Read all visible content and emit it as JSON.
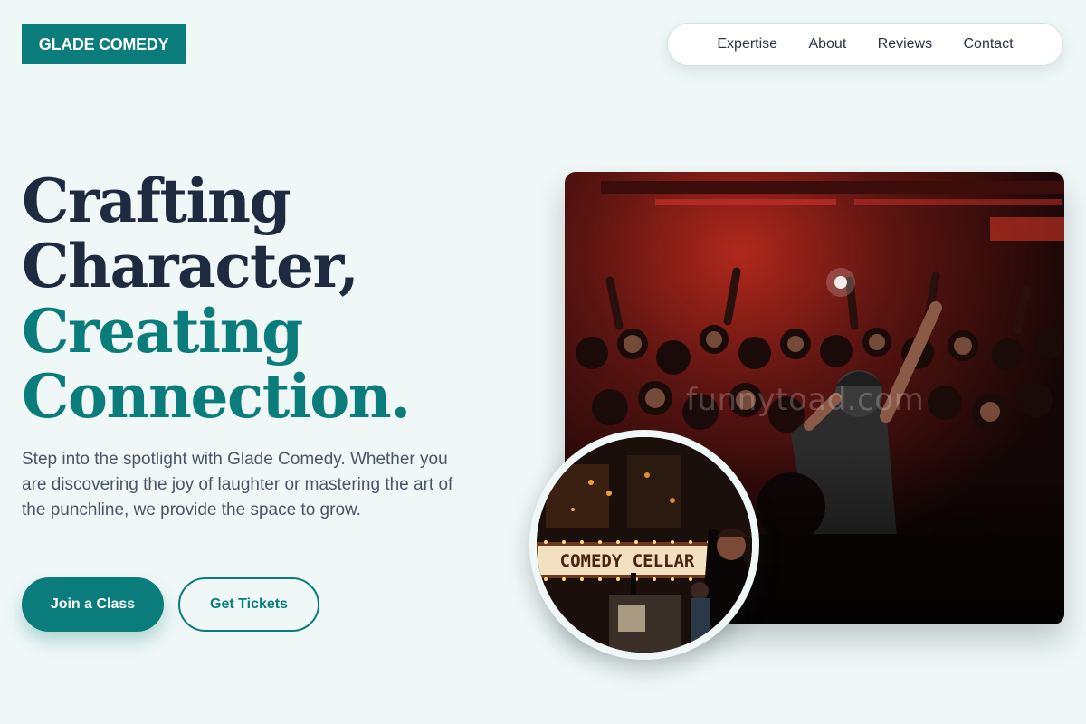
{
  "brand": {
    "logo_text": "GLADE COMEDY",
    "accent_color": "#0a7c7b",
    "heading_color": "#1e2a40",
    "background_color": "#eff7f7"
  },
  "nav": {
    "items": [
      {
        "label": "Expertise"
      },
      {
        "label": "About"
      },
      {
        "label": "Reviews"
      },
      {
        "label": "Contact"
      }
    ]
  },
  "hero": {
    "headline_line1": "Crafting",
    "headline_line2": "Character,",
    "headline_line3": "Creating",
    "headline_line4": "Connection.",
    "description": "Step into the spotlight with Glade Comedy. Whether you are discovering the joy of laughter or mastering the art of the punchline, we provide the space to grow.",
    "primary_button": "Join a Class",
    "secondary_button": "Get Tickets"
  },
  "images": {
    "main_photo_icon": "comedy-crowd-photo",
    "main_photo_watermark": "funnytoad.com",
    "circle_photo_icon": "comedy-cellar-marquee-photo",
    "marquee_text": "COMEDY CELLAR"
  }
}
